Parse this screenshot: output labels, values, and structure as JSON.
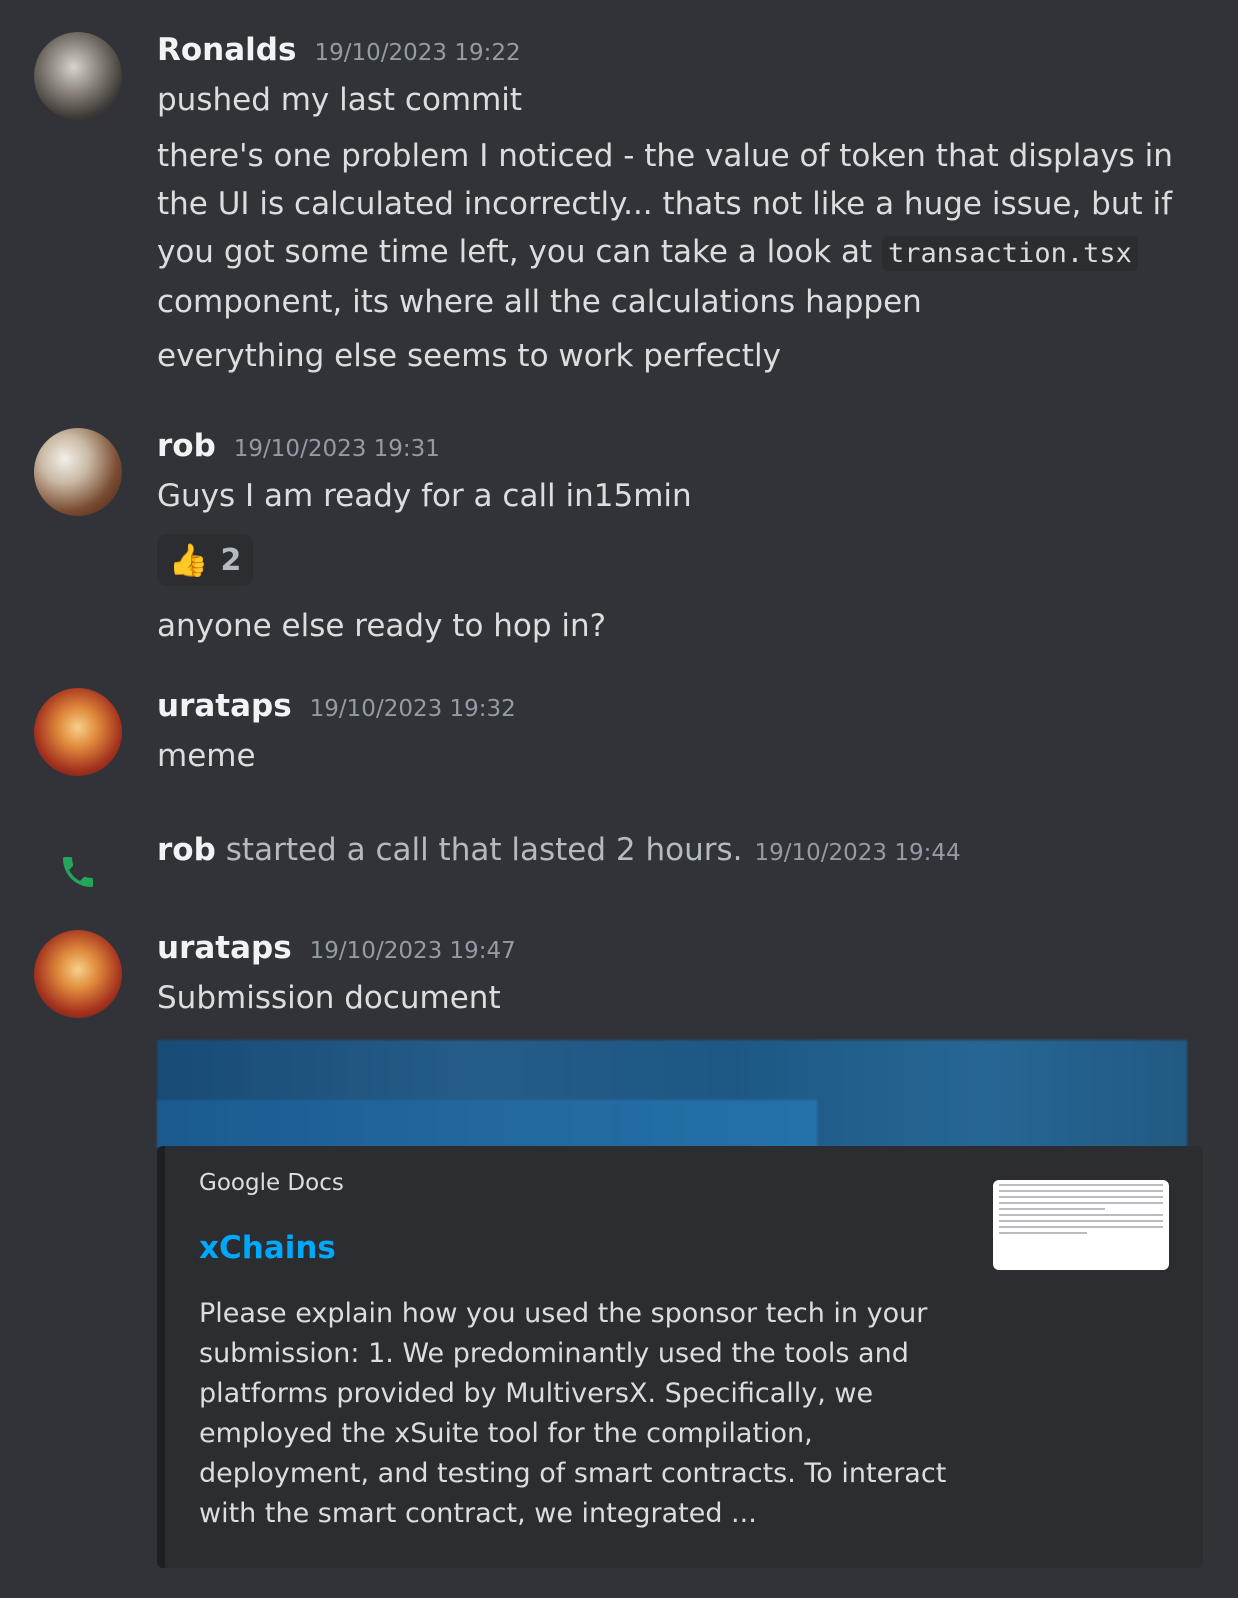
{
  "messages": [
    {
      "author": "Ronalds",
      "timestamp": "19/10/2023 19:22",
      "lines": [
        "pushed my last commit",
        "there's one problem I noticed - the value of token that displays in the UI is calculated incorrectly... thats not like a huge issue, but if you got some time left, you can take a look at",
        "transaction.tsx",
        "component, its where all the calculations happen",
        "everything else seems to work perfectly"
      ]
    },
    {
      "author": "rob",
      "timestamp": "19/10/2023 19:31",
      "lines": [
        "Guys I am ready for a call in15min",
        "anyone else ready to hop in?"
      ],
      "reaction": {
        "emoji": "👍",
        "count": "2"
      }
    },
    {
      "author": "urataps",
      "timestamp": "19/10/2023 19:32",
      "lines": [
        "meme"
      ]
    },
    {
      "author": "urataps",
      "timestamp": "19/10/2023 19:47",
      "lines": [
        "Submission document"
      ],
      "embed": {
        "provider": "Google Docs",
        "title": "xChains",
        "description": "Please explain how you used the sponsor tech in your submission:   1. We predominantly used the tools and platforms provided by MultiversX. Specifically, we employed the xSuite tool for the compilation, deployment, and testing of smart contracts. To interact with the smart contract, we integrated ..."
      }
    }
  ],
  "call": {
    "author": "rob",
    "text": "started a call that lasted 2 hours.",
    "timestamp": "19/10/2023 19:44",
    "icon": "phone-icon",
    "color": "#23a55a"
  },
  "colors": {
    "background": "#313338",
    "text": "#dbdee1",
    "muted": "#949ba4",
    "link": "#00a8fc"
  }
}
